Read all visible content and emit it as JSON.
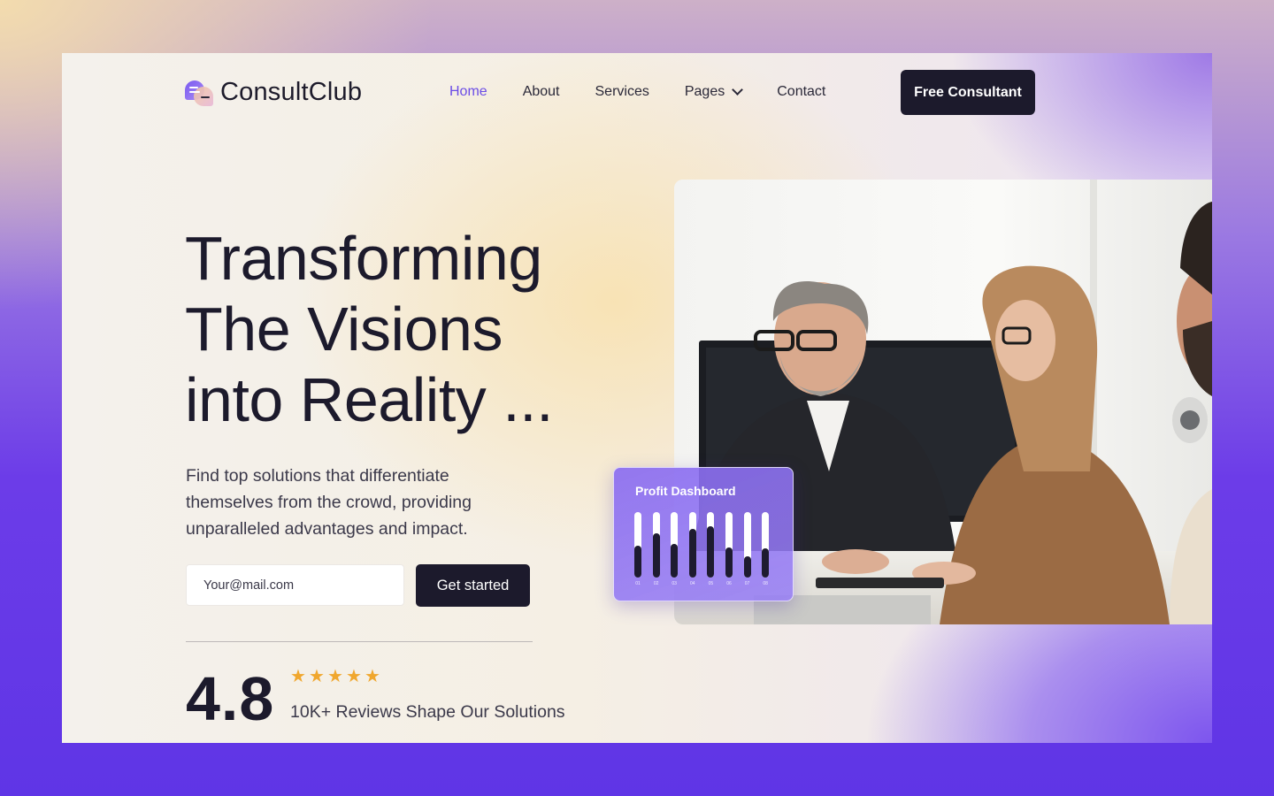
{
  "brand": {
    "name": "ConsultClub",
    "accent": "#6b4ce6",
    "dark": "#1c1a2c"
  },
  "nav": {
    "items": [
      {
        "label": "Home",
        "active": true
      },
      {
        "label": "About"
      },
      {
        "label": "Services"
      },
      {
        "label": "Pages",
        "dropdown": true
      },
      {
        "label": "Contact"
      }
    ],
    "cta": "Free Consultant"
  },
  "hero": {
    "headline": [
      "Transforming",
      "The Visions",
      "into Reality ..."
    ],
    "subtitle": "Find top solutions that differentiate themselves from the crowd, providing unparalleled advantages and impact.",
    "email_placeholder": "Your@mail.com",
    "cta": "Get started"
  },
  "rating": {
    "value": "4.8",
    "stars": 5,
    "star_color": "#f0a72e",
    "caption": "10K+ Reviews Shape Our Solutions"
  },
  "dashboard": {
    "title": "Profit Dashboard",
    "bars": [
      {
        "label": "01",
        "value": 0.48
      },
      {
        "label": "02",
        "value": 0.68
      },
      {
        "label": "03",
        "value": 0.52
      },
      {
        "label": "04",
        "value": 0.74
      },
      {
        "label": "05",
        "value": 0.78
      },
      {
        "label": "06",
        "value": 0.46
      },
      {
        "label": "07",
        "value": 0.32
      },
      {
        "label": "08",
        "value": 0.44
      }
    ]
  },
  "icons": {
    "logo": "speech-bubbles-icon",
    "chevron": "chevron-down-icon",
    "star": "star-icon"
  }
}
